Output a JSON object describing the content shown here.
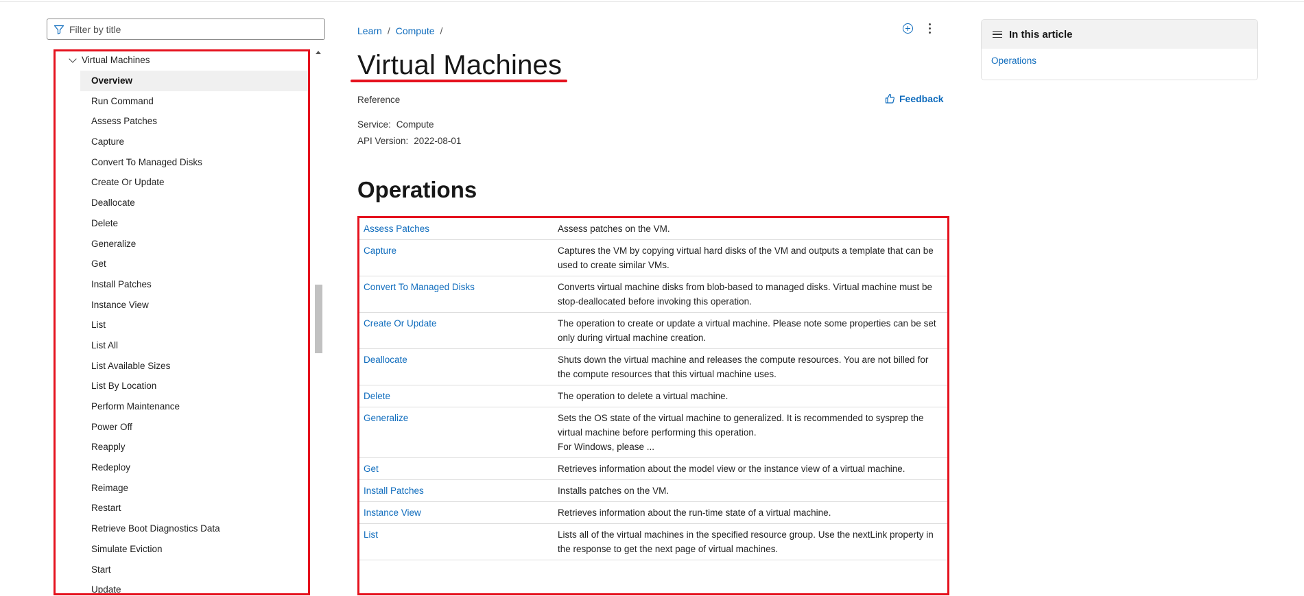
{
  "filter": {
    "placeholder": "Filter by title"
  },
  "nav": {
    "parent": "Virtual Machines",
    "items": [
      {
        "label": "Overview",
        "active": true
      },
      {
        "label": "Run Command"
      },
      {
        "label": "Assess Patches"
      },
      {
        "label": "Capture"
      },
      {
        "label": "Convert To Managed Disks"
      },
      {
        "label": "Create Or Update"
      },
      {
        "label": "Deallocate"
      },
      {
        "label": "Delete"
      },
      {
        "label": "Generalize"
      },
      {
        "label": "Get"
      },
      {
        "label": "Install Patches"
      },
      {
        "label": "Instance View"
      },
      {
        "label": "List"
      },
      {
        "label": "List All"
      },
      {
        "label": "List Available Sizes"
      },
      {
        "label": "List By Location"
      },
      {
        "label": "Perform Maintenance"
      },
      {
        "label": "Power Off"
      },
      {
        "label": "Reapply"
      },
      {
        "label": "Redeploy"
      },
      {
        "label": "Reimage"
      },
      {
        "label": "Restart"
      },
      {
        "label": "Retrieve Boot Diagnostics Data"
      },
      {
        "label": "Simulate Eviction"
      },
      {
        "label": "Start"
      },
      {
        "label": "Update"
      }
    ]
  },
  "breadcrumb": {
    "items": [
      "Learn",
      "Compute"
    ],
    "separator": "/"
  },
  "page": {
    "title": "Virtual Machines",
    "type": "Reference",
    "feedback_label": "Feedback",
    "service_key": "Service:",
    "service_value": "Compute",
    "api_key": "API Version:",
    "api_value": "2022-08-01",
    "operations_heading": "Operations"
  },
  "operations": [
    {
      "name": "Assess Patches",
      "desc": [
        "Assess patches on the VM."
      ]
    },
    {
      "name": "Capture",
      "desc": [
        "Captures the VM by copying virtual hard disks of the VM and outputs a template that can be used to create similar VMs."
      ]
    },
    {
      "name": "Convert To Managed Disks",
      "desc": [
        "Converts virtual machine disks from blob-based to managed disks. Virtual machine must be stop-deallocated before invoking this operation."
      ]
    },
    {
      "name": "Create Or Update",
      "desc": [
        "The operation to create or update a virtual machine. Please note some properties can be set only during virtual machine creation."
      ]
    },
    {
      "name": "Deallocate",
      "desc": [
        "Shuts down the virtual machine and releases the compute resources. You are not billed for the compute resources that this virtual machine uses."
      ]
    },
    {
      "name": "Delete",
      "desc": [
        "The operation to delete a virtual machine."
      ]
    },
    {
      "name": "Generalize",
      "desc": [
        "Sets the OS state of the virtual machine to generalized. It is recommended to sysprep the virtual machine before performing this operation.",
        "For Windows, please ..."
      ]
    },
    {
      "name": "Get",
      "desc": [
        "Retrieves information about the model view or the instance view of a virtual machine."
      ]
    },
    {
      "name": "Install Patches",
      "desc": [
        "Installs patches on the VM."
      ]
    },
    {
      "name": "Instance View",
      "desc": [
        "Retrieves information about the run-time state of a virtual machine."
      ]
    },
    {
      "name": "List",
      "desc": [
        "Lists all of the virtual machines in the specified resource group. Use the nextLink property in the response to get the next page of virtual machines."
      ]
    }
  ],
  "toc": {
    "heading": "In this article",
    "links": [
      "Operations"
    ]
  },
  "colors": {
    "link": "#0f6cbd",
    "highlight": "#e5121e"
  }
}
